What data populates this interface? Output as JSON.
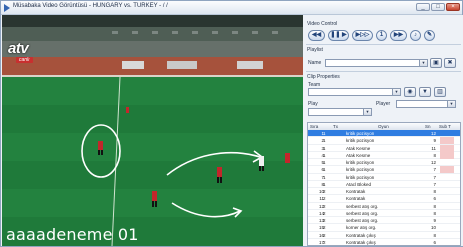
{
  "window": {
    "title": "Müsabaka Video Görüntüsü - HUNGARY vs. TURKEY - / /",
    "minimize": "_",
    "maximize": "□",
    "close": "×"
  },
  "video": {
    "channel_logo": "atv",
    "live_badge": "canlı",
    "caption": "aaaadeneme 01"
  },
  "panel": {
    "video_control_label": "Video Control",
    "controls": [
      {
        "icon": "rewind-icon",
        "glyph": "◀◀"
      },
      {
        "icon": "play-pause-icon",
        "glyph": "❚❚ ▶"
      },
      {
        "icon": "step-forward-icon",
        "glyph": "▶▷▷"
      },
      {
        "icon": "speed-icon",
        "glyph": "1"
      },
      {
        "icon": "fast-forward-icon",
        "glyph": "▶▶"
      },
      {
        "icon": "volume-icon",
        "glyph": "♪"
      },
      {
        "icon": "pen-icon",
        "glyph": "✎"
      }
    ],
    "playlist_label": "Playlist",
    "name_label": "Name",
    "name_value": "",
    "clip_properties_label": "Clip Properties",
    "team_label": "Team",
    "team_value": "",
    "play_label": "Play",
    "play_value": "",
    "player_label": "Player",
    "player_value": "",
    "save_icon": "save-icon",
    "delete_icon": "delete-icon",
    "target_icon": "target-icon",
    "filter_icon": "filter-icon",
    "trash_icon": "trash-icon"
  },
  "table": {
    "headers": {
      "sira": "Sıra",
      "tx": "Tx",
      "oyun": "Oyun",
      "sn": "Sn",
      "sub": "Sub T"
    },
    "rows": [
      {
        "sira": "1",
        "tx": "1",
        "oyun": "kritik pozisyon",
        "sn": "12",
        "mark": false,
        "selected": true
      },
      {
        "sira": "2",
        "tx": "1",
        "oyun": "kritik pozisyon",
        "sn": "9",
        "mark": true,
        "selected": false
      },
      {
        "sira": "3",
        "tx": "1",
        "oyun": "Atak Kesme",
        "sn": "11",
        "mark": true,
        "selected": false
      },
      {
        "sira": "4",
        "tx": "1",
        "oyun": "Atak Kesme",
        "sn": "8",
        "mark": true,
        "selected": false
      },
      {
        "sira": "5",
        "tx": "1",
        "oyun": "kritik pozisyon",
        "sn": "12",
        "mark": false,
        "selected": false
      },
      {
        "sira": "6",
        "tx": "1",
        "oyun": "kritik pozisyon",
        "sn": "7",
        "mark": true,
        "selected": false
      },
      {
        "sira": "7",
        "tx": "1",
        "oyun": "kritik pozisyon",
        "sn": "7",
        "mark": false,
        "selected": false
      },
      {
        "sira": "8",
        "tx": "1",
        "oyun": "Atacl Bloked",
        "sn": "7",
        "mark": false,
        "selected": false
      },
      {
        "sira": "10",
        "tx": "2",
        "oyun": "Kontratak",
        "sn": "8",
        "mark": false,
        "selected": false
      },
      {
        "sira": "11",
        "tx": "2",
        "oyun": "Kontratak",
        "sn": "6",
        "mark": false,
        "selected": false
      },
      {
        "sira": "12",
        "tx": "2",
        "oyun": "serbest atış org.",
        "sn": "8",
        "mark": false,
        "selected": false
      },
      {
        "sira": "14",
        "tx": "2",
        "oyun": "serbest atış org.",
        "sn": "8",
        "mark": false,
        "selected": false
      },
      {
        "sira": "13",
        "tx": "2",
        "oyun": "serbest atış org.",
        "sn": "9",
        "mark": false,
        "selected": false
      },
      {
        "sira": "15",
        "tx": "2",
        "oyun": "korner atış org.",
        "sn": "10",
        "mark": false,
        "selected": false
      },
      {
        "sira": "16",
        "tx": "2",
        "oyun": "Kontratak çıkış",
        "sn": "8",
        "mark": false,
        "selected": false
      },
      {
        "sira": "17",
        "tx": "2",
        "oyun": "Kontratak çıkış",
        "sn": "6",
        "mark": false,
        "selected": false
      }
    ]
  },
  "colors": {
    "pitch": "#1f7a3a",
    "selection": "#2f7de1",
    "sub_mark": "#f4c9c9",
    "panel_bg": "#eef2f7"
  }
}
